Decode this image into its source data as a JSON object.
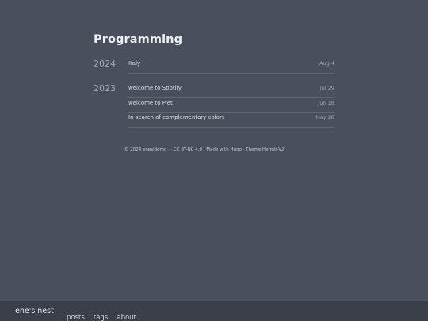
{
  "page": {
    "title": "Programming"
  },
  "archive": [
    {
      "year": "2024",
      "posts": [
        {
          "title": "Italy",
          "date": "Aug 4"
        }
      ]
    },
    {
      "year": "2023",
      "posts": [
        {
          "title": "welcome to Spotify",
          "date": "Jul 29"
        },
        {
          "title": "welcome to Piet",
          "date": "Jun 18"
        },
        {
          "title": "In search of complementary colors",
          "date": "May 28"
        }
      ]
    }
  ],
  "footer": {
    "text": "© 2024 enesidemo · · CC BY-NC 4.0 · Made with Hugo · Theme Hermit-V2"
  },
  "header": {
    "site_title": "ene's nest",
    "nav": [
      "posts",
      "tags",
      "about"
    ]
  },
  "colors": {
    "background": "#494f5c",
    "bottom_bar": "#3b3f4a"
  }
}
